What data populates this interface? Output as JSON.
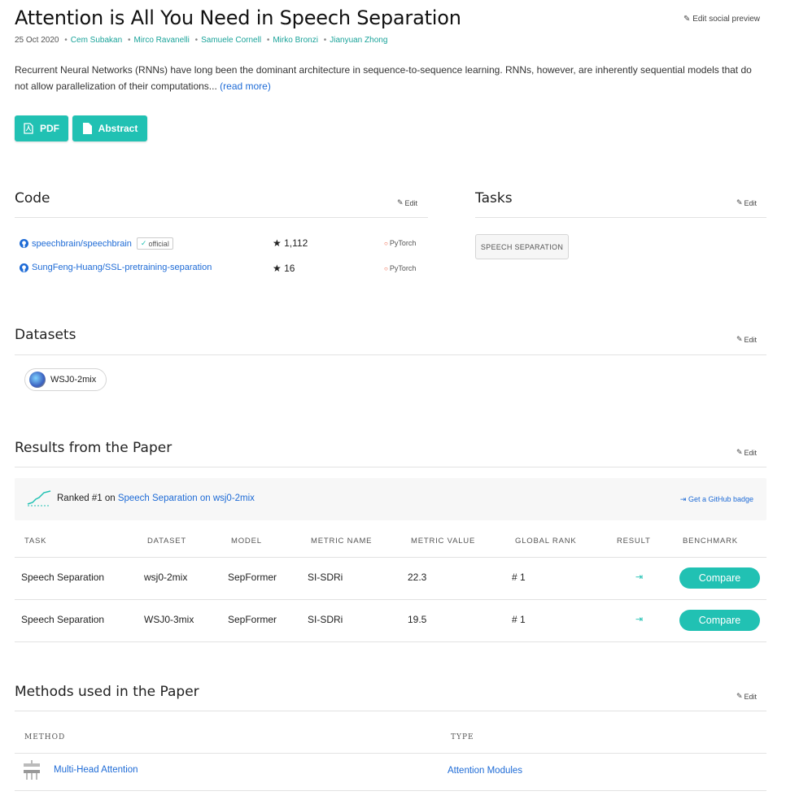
{
  "paper": {
    "title": "Attention is All You Need in Speech Separation",
    "date": "25 Oct 2020",
    "authors": [
      "Cem Subakan",
      "Mirco Ravanelli",
      "Samuele Cornell",
      "Mirko Bronzi",
      "Jianyuan Zhong"
    ],
    "abstract": "Recurrent Neural Networks (RNNs) have long been the dominant architecture in sequence-to-sequence learning. RNNs, however, are inherently sequential models that do not allow parallelization of their computations...",
    "read_more": "(read more)",
    "edit_social": "Edit social preview"
  },
  "buttons": {
    "pdf": "PDF",
    "abstract": "Abstract"
  },
  "edit_label": "Edit",
  "code": {
    "title": "Code",
    "repos": [
      {
        "name": "speechbrain/speechbrain",
        "official": "official",
        "stars": "1,112",
        "framework": "PyTorch"
      },
      {
        "name": "SungFeng-Huang/SSL-pretraining-separation",
        "official": "",
        "stars": "16",
        "framework": "PyTorch"
      }
    ]
  },
  "tasks": {
    "title": "Tasks",
    "items": [
      "SPEECH SEPARATION"
    ]
  },
  "datasets": {
    "title": "Datasets",
    "items": [
      "WSJ0-2mix"
    ]
  },
  "results": {
    "title": "Results from the Paper",
    "ranked_prefix": "Ranked #1 on ",
    "ranked_link": "Speech Separation on wsj0-2mix",
    "github_badge": "Get a GitHub badge",
    "headers": [
      "TASK",
      "DATASET",
      "MODEL",
      "METRIC NAME",
      "METRIC VALUE",
      "GLOBAL RANK",
      "RESULT",
      "BENCHMARK"
    ],
    "rows": [
      {
        "task": "Speech Separation",
        "dataset": "wsj0-2mix",
        "model": "SepFormer",
        "metric": "SI-SDRi",
        "value": "22.3",
        "rank": "# 1",
        "compare": "Compare"
      },
      {
        "task": "Speech Separation",
        "dataset": "WSJ0-3mix",
        "model": "SepFormer",
        "metric": "SI-SDRi",
        "value": "19.5",
        "rank": "# 1",
        "compare": "Compare"
      }
    ]
  },
  "methods": {
    "title": "Methods used in the Paper",
    "headers": [
      "METHOD",
      "TYPE"
    ],
    "rows": [
      {
        "method": "Multi-Head Attention",
        "type": "Attention Modules"
      }
    ]
  },
  "colors": {
    "accent": "#21c1b3",
    "link": "#1e6bd6",
    "author": "#1aa39a"
  }
}
